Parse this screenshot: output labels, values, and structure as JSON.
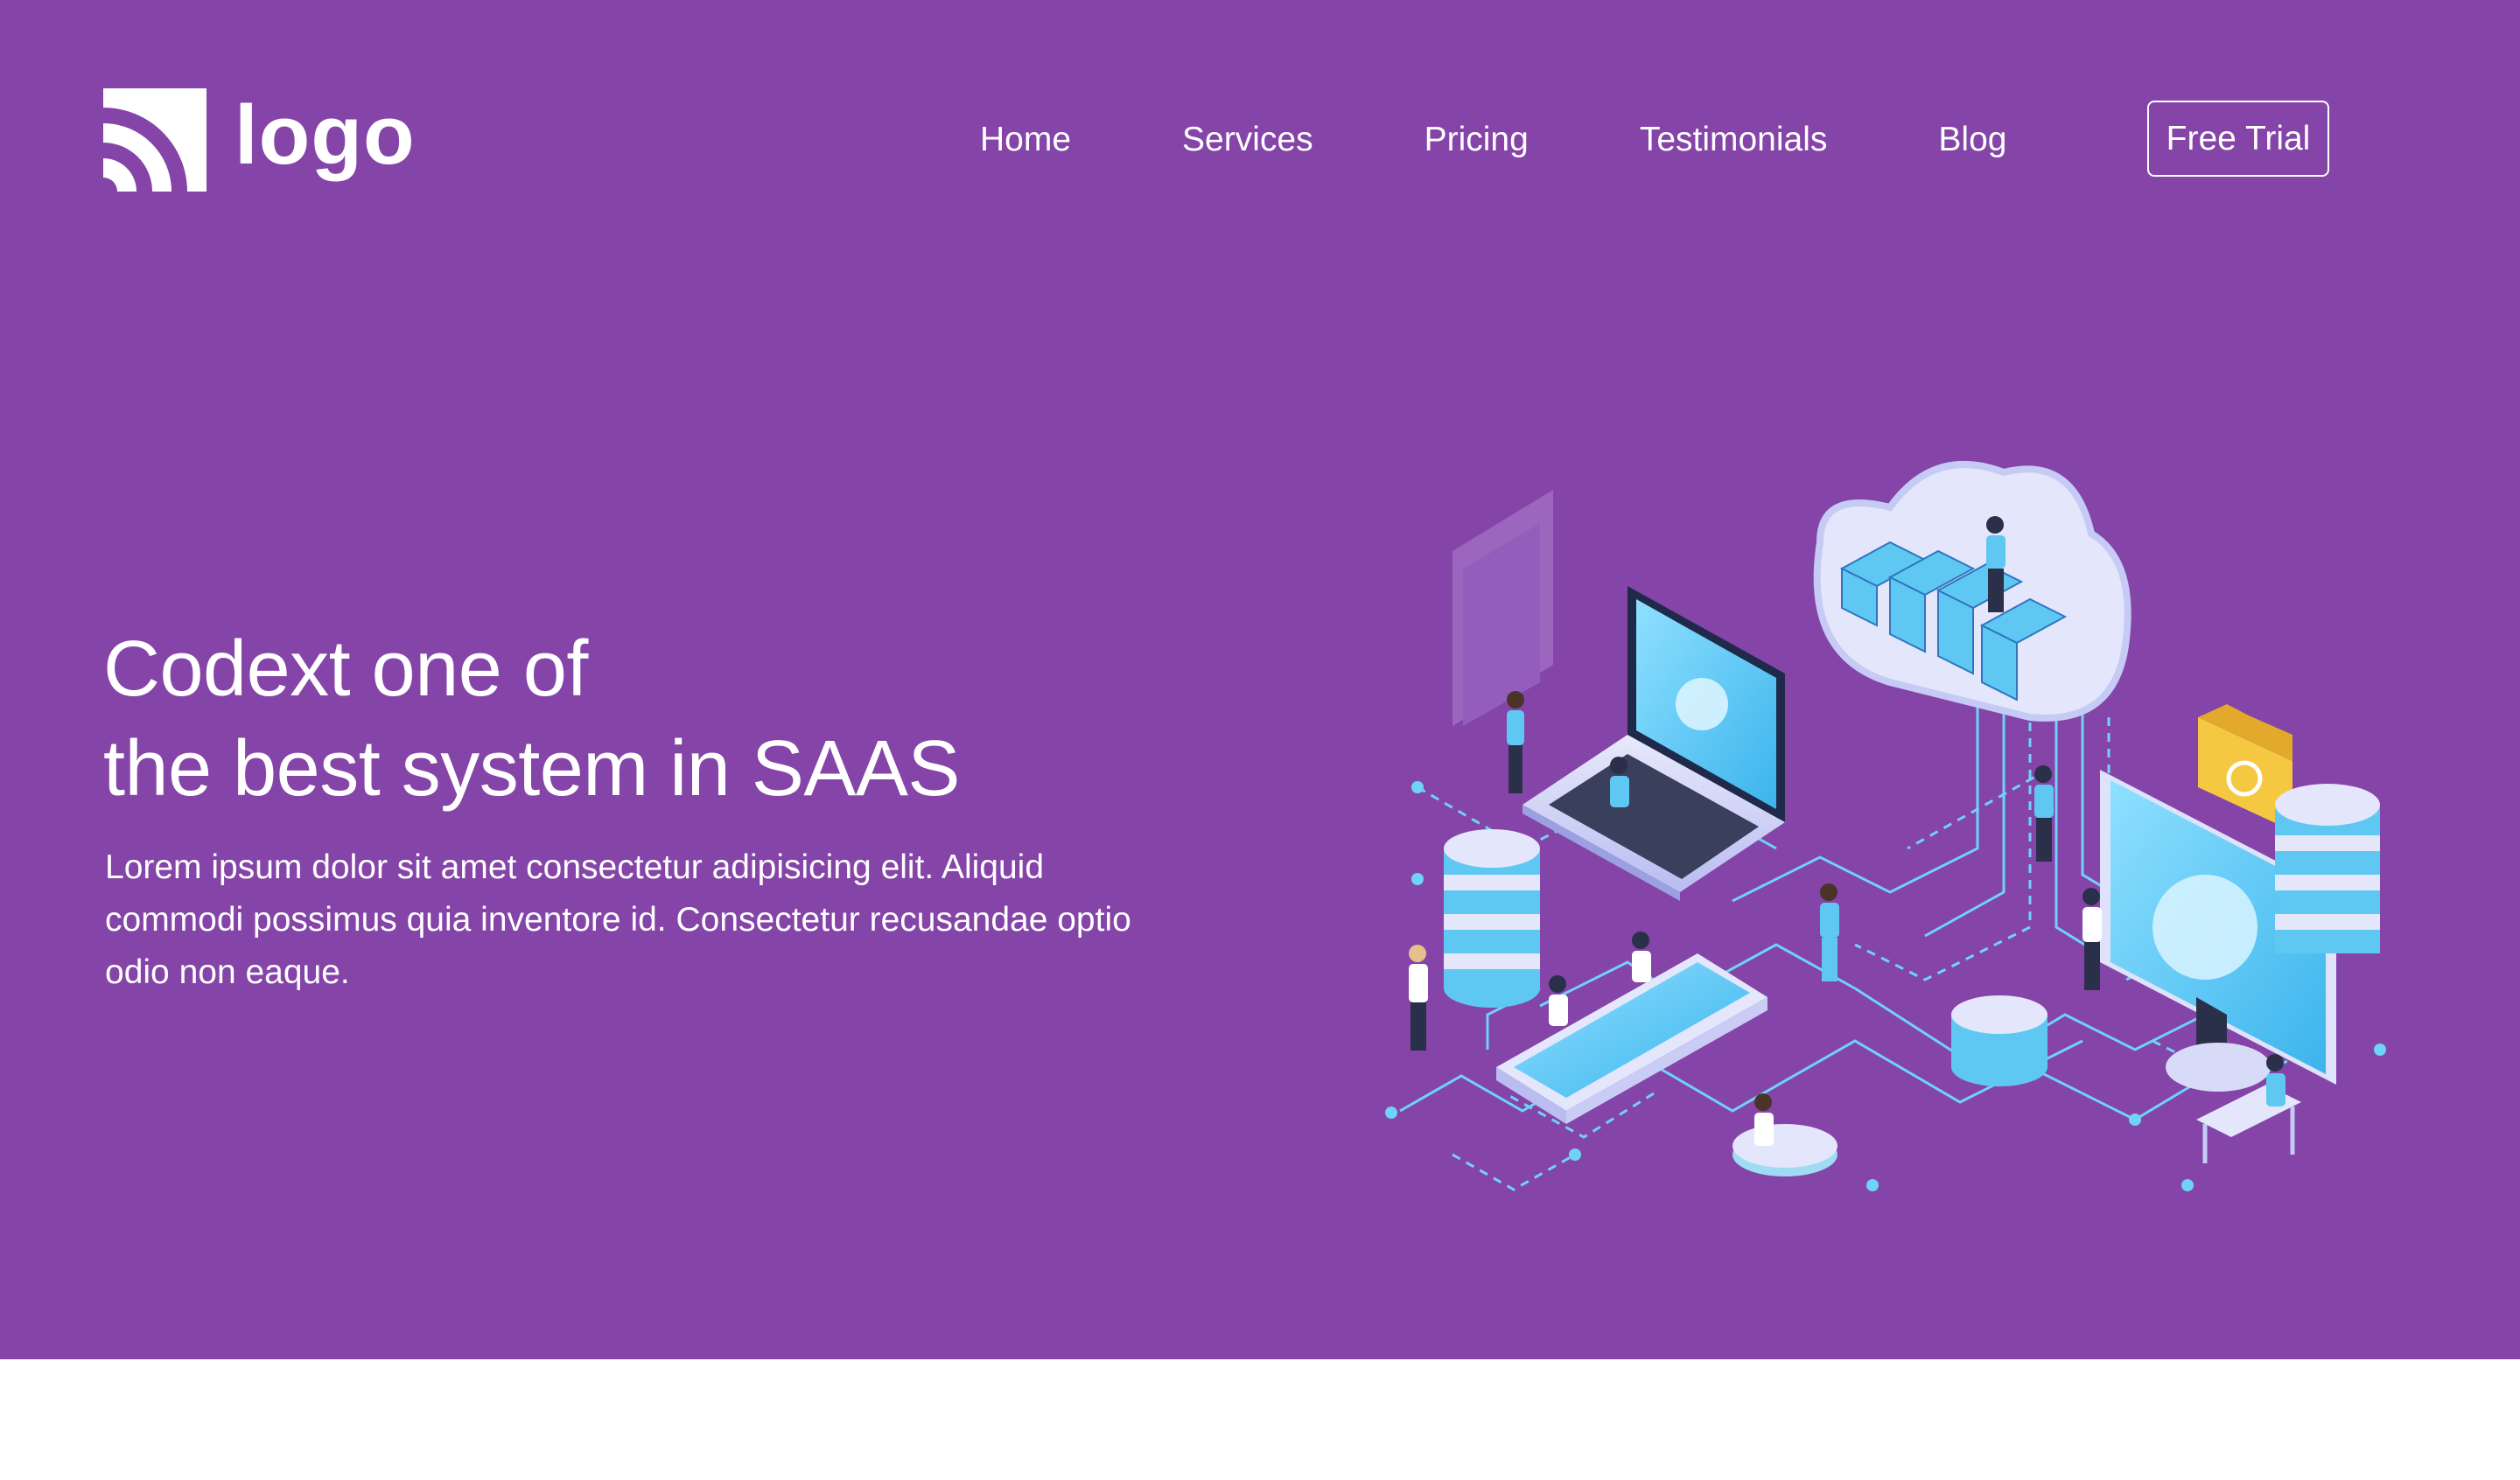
{
  "header": {
    "logo_text": "logo",
    "logo_icon": "signal-arcs-icon"
  },
  "nav": {
    "items": [
      {
        "label": "Home"
      },
      {
        "label": "Services"
      },
      {
        "label": "Pricing"
      },
      {
        "label": "Testimonials"
      },
      {
        "label": "Blog"
      }
    ],
    "cta_label": "Free Trial"
  },
  "hero": {
    "headline_line1": "Codext one of",
    "headline_line2": "the best system in SAAS",
    "description": "Lorem ipsum dolor sit amet consectetur adipisicing elit. Aliquid commodi possimus quia inventore id. Consectetur recusandae optio odio non eaque.",
    "illustration": "isometric-cloud-saas-illustration"
  },
  "colors": {
    "hero_background": "#8544a8",
    "text": "#ffffff",
    "accent_blue": "#5ec8f2",
    "accent_yellow": "#f5c842",
    "page_background": "#ffffff"
  }
}
